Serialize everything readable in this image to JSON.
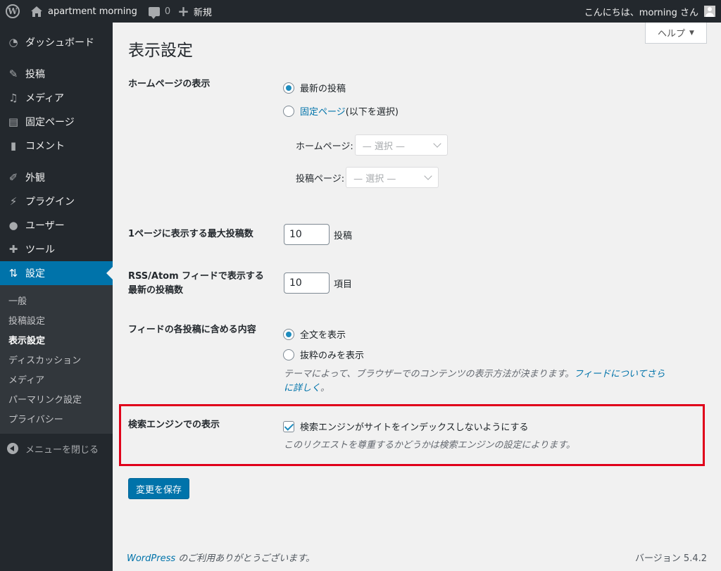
{
  "adminbar": {
    "site_name": "apartment morning",
    "comments_count": "0",
    "new_label": "新規",
    "greeting": "こんにちは、morning さん"
  },
  "sidebar": {
    "items": [
      {
        "label": "ダッシュボード",
        "icon": "dashboard-icon"
      },
      {
        "label": "投稿",
        "icon": "pin-icon"
      },
      {
        "label": "メディア",
        "icon": "media-icon"
      },
      {
        "label": "固定ページ",
        "icon": "page-icon"
      },
      {
        "label": "コメント",
        "icon": "comment-icon"
      },
      {
        "label": "外観",
        "icon": "brush-icon"
      },
      {
        "label": "プラグイン",
        "icon": "plugin-icon"
      },
      {
        "label": "ユーザー",
        "icon": "user-icon"
      },
      {
        "label": "ツール",
        "icon": "wrench-icon"
      },
      {
        "label": "設定",
        "icon": "settings-icon"
      }
    ],
    "submenu": [
      "一般",
      "投稿設定",
      "表示設定",
      "ディスカッション",
      "メディア",
      "パーマリンク設定",
      "プライバシー"
    ],
    "collapse_label": "メニューを閉じる"
  },
  "help_label": "ヘルプ",
  "page_title": "表示設定",
  "homepage": {
    "label": "ホームページの表示",
    "option_latest": "最新の投稿",
    "option_static_link": "固定ページ",
    "option_static_suffix": " (以下を選択)",
    "selected": "latest",
    "front_label": "ホームページ:",
    "front_value": "— 選択 —",
    "posts_label": "投稿ページ:",
    "posts_value": "— 選択 —"
  },
  "posts_per_page": {
    "label": "1ページに表示する最大投稿数",
    "value": "10",
    "unit": "投稿"
  },
  "feed_count": {
    "label_line1": "RSS/Atom フィードで表示する",
    "label_line2": "最新の投稿数",
    "value": "10",
    "unit": "項目"
  },
  "feed_content": {
    "label": "フィードの各投稿に含める内容",
    "option_full": "全文を表示",
    "option_summary": "抜粋のみを表示",
    "selected": "full",
    "desc_line1": "テーマによって、ブラウザーでのコンテンツの表示方法が決まります。",
    "desc_link1": "フィードについてさら",
    "desc_link2": "に詳しく",
    "desc_end": "。"
  },
  "search_engine": {
    "label": "検索エンジンでの表示",
    "checkbox_label": "検索エンジンがサイトをインデックスしないようにする",
    "checked": true,
    "desc": "このリクエストを尊重するかどうかは検索エンジンの設定によります。"
  },
  "save_label": "変更を保存",
  "footer": {
    "link": "WordPress",
    "text": " のご利用ありがとうございます。",
    "version": "バージョン 5.4.2"
  },
  "colors": {
    "accent": "#0073aa",
    "highlight_border": "#e0001a",
    "sidebar_bg": "#23282d"
  }
}
